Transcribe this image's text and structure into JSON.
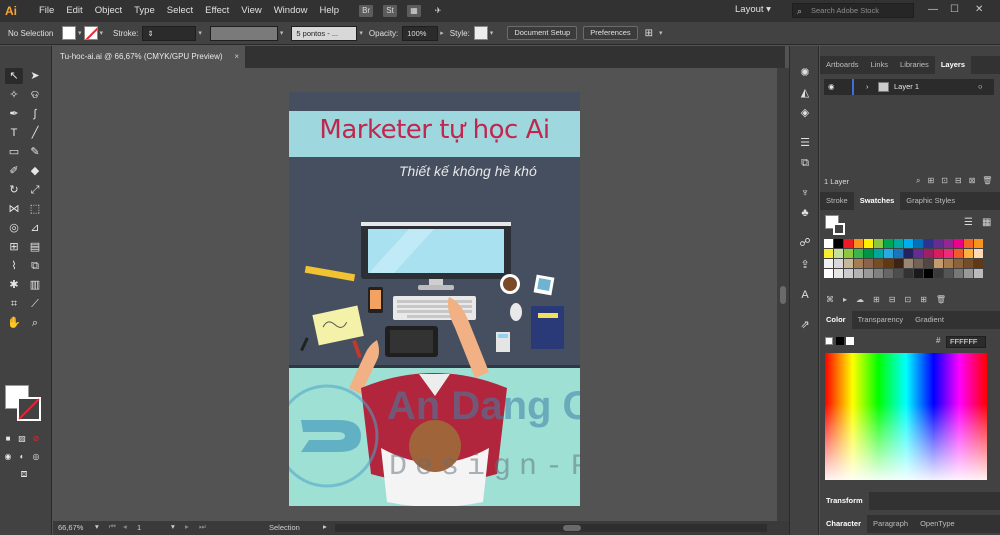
{
  "app": {
    "logo": "Ai",
    "workspace": "Layout",
    "stock_search_placeholder": "Search Adobe Stock"
  },
  "menu": [
    "File",
    "Edit",
    "Object",
    "Type",
    "Select",
    "Effect",
    "View",
    "Window",
    "Help"
  ],
  "menubar_icons": {
    "bridge": "Br",
    "stock": "St",
    "arrange": "▦",
    "gpu": "✈"
  },
  "control": {
    "selection": "No Selection",
    "stroke_label": "Stroke:",
    "brush": "5 pontos - ...",
    "opacity_label": "Opacity:",
    "opacity_value": "100%",
    "style_label": "Style:",
    "document_setup": "Document Setup",
    "preferences": "Preferences"
  },
  "document": {
    "tab": "Tu-hoc-ai.ai @ 66,67% (CMYK/GPU Preview)",
    "close": "×"
  },
  "artwork": {
    "title": "Marketer tự học Ai",
    "subtitle": "Thiết kế không hề khó",
    "watermark_company": "An Dang Co., Ltd",
    "watermark_tagline": "Design-Printing"
  },
  "status": {
    "zoom": "66,67%",
    "page": "1",
    "tool": "Selection"
  },
  "panels": {
    "top_tabs": [
      "Artboards",
      "Links",
      "Libraries",
      "Layers"
    ],
    "layer_name": "Layer 1",
    "layer_count": "1 Layer",
    "mid_tabs": [
      "Stroke",
      "Swatches",
      "Graphic Styles"
    ],
    "color_tabs": [
      "Color",
      "Transparency",
      "Gradient"
    ],
    "hex": "FFFFFF",
    "transform": "Transform",
    "bottom_tabs": [
      "Character",
      "Paragraph",
      "OpenType"
    ]
  },
  "swatches": [
    "#ffffff",
    "#000000",
    "#ed1c24",
    "#f7941d",
    "#fff200",
    "#8dc63f",
    "#00a651",
    "#00a99d",
    "#00aeef",
    "#0072bc",
    "#2e3192",
    "#662d91",
    "#92278f",
    "#ec008c",
    "#f26522",
    "#f7941d",
    "#f9ed32",
    "#c4df9b",
    "#8dc73f",
    "#39b54a",
    "#009444",
    "#00a79d",
    "#27aae1",
    "#1b75bc",
    "#262262",
    "#652d90",
    "#9e1f63",
    "#da1c5c",
    "#ee2a7b",
    "#f15a29",
    "#fbb040",
    "#fdd9b5",
    "#f2f2f2",
    "#d9d9d9",
    "#c8b89a",
    "#a67c52",
    "#8b6348",
    "#754c24",
    "#603913",
    "#3c2415",
    "#998675",
    "#736357",
    "#534741",
    "#c69c6d",
    "#a97c50",
    "#8c6239",
    "#754c29",
    "#603813",
    "#ffffff",
    "#e6e6e6",
    "#cccccc",
    "#b3b3b3",
    "#999999",
    "#808080",
    "#666666",
    "#4d4d4d",
    "#333333",
    "#1a1a1a",
    "#000000",
    "#3a3a3a",
    "#555555",
    "#777777",
    "#999999",
    "#bbbbbb"
  ]
}
